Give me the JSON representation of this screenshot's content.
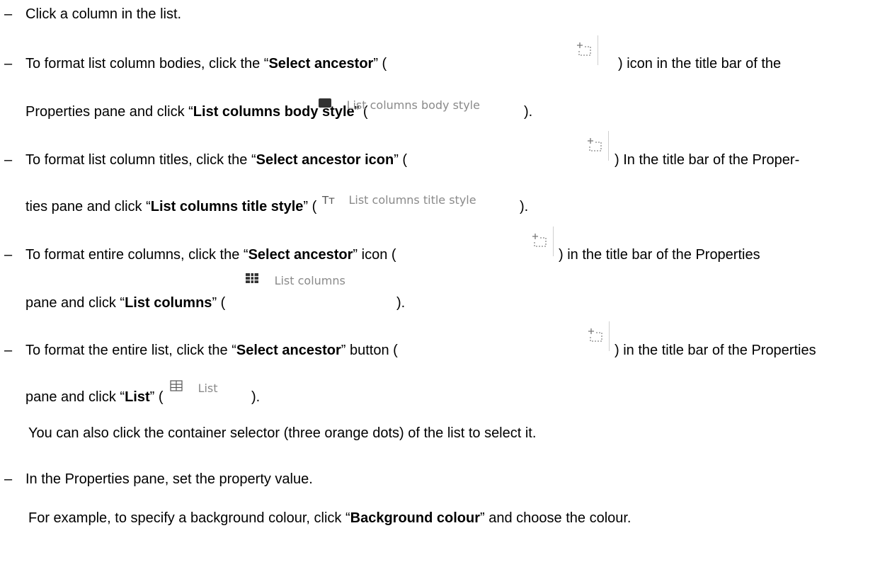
{
  "bullets": [
    {
      "dash": "–",
      "text": "Click a column in the list."
    },
    {
      "dash": "–",
      "line1_a": "To format list column bodies, click the “",
      "line1_b": "Select ancestor",
      "line1_c": "” (",
      "line1_d": ") icon in the title bar of the",
      "line2_a": "Properties pane and click “",
      "line2_b": "List columns body style",
      "line2_c": "” (",
      "line2_label": "List columns body style",
      "line2_d": ")."
    },
    {
      "dash": "–",
      "line1_a": "To format list column titles, click the “",
      "line1_b": "Select ancestor icon",
      "line1_c": "” (",
      "line1_d": ") In the title bar of the Proper-",
      "line2_a": "ties pane and click “",
      "line2_b": "List columns title style",
      "line2_c": "” (",
      "line2_glyph": "Tᴛ",
      "line2_label": "List columns title style",
      "line2_d": ")."
    },
    {
      "dash": "–",
      "line1_a": "To format entire columns, click the “",
      "line1_b": "Select ancestor",
      "line1_c": "” icon (",
      "line1_d": ") in the title bar of the Properties",
      "line2_a": "pane and click “",
      "line2_b": "List columns",
      "line2_c": "” (",
      "line2_label": "List columns",
      "line2_d": ")."
    },
    {
      "dash": "–",
      "line1_a": "To format the entire list, click the “",
      "line1_b": "Select ancestor",
      "line1_c": "” button (",
      "line1_d": ") in the title bar of the Properties",
      "line2_a": "pane and click “",
      "line2_b": "List",
      "line2_c": "” (",
      "line2_label": "List",
      "line2_d": ")."
    }
  ],
  "note_container": "You can also click the container selector (three orange dots) of the list to select it.",
  "bullet_properties": {
    "dash": "–",
    "text": "In the Properties pane, set the property value."
  },
  "example": {
    "a": "For example, to specify a background colour, click “",
    "b": "Background colour",
    "c": "” and choose the colour."
  },
  "icons": {
    "select_ancestor": "select-ancestor-icon",
    "body_style": "body-style-icon",
    "title_style": "title-style-icon",
    "list_columns": "list-columns-icon",
    "list": "list-table-icon"
  }
}
